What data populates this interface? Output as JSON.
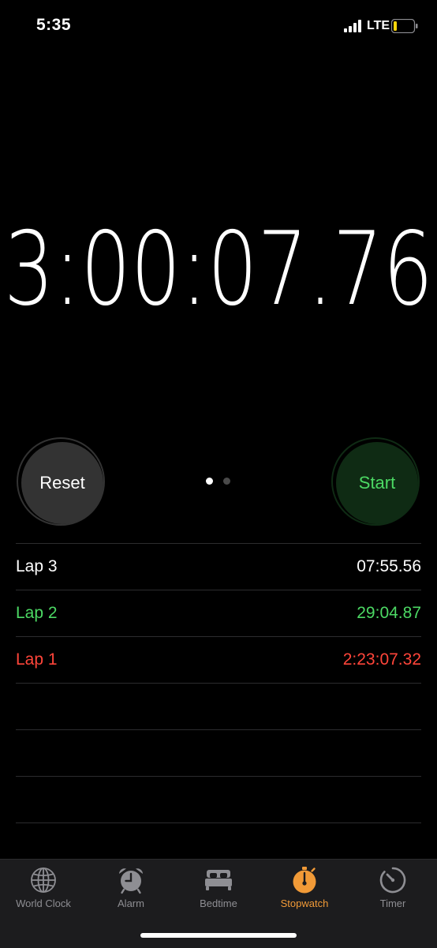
{
  "status_bar": {
    "time": "5:35",
    "network": "LTE",
    "icons": [
      "signal-bars-icon",
      "battery-low-icon"
    ]
  },
  "stopwatch": {
    "elapsed": "3:00:07.76"
  },
  "controls": {
    "reset_label": "Reset",
    "start_label": "Start",
    "page_count": 2,
    "active_page": 1
  },
  "laps": [
    {
      "name": "Lap 3",
      "time": "07:55.56",
      "color": "#ffffff"
    },
    {
      "name": "Lap 2",
      "time": "29:04.87",
      "color": "#4cd964"
    },
    {
      "name": "Lap 1",
      "time": "2:23:07.32",
      "color": "#ff453a"
    }
  ],
  "tab_bar": {
    "accent_color": "#f19a37",
    "tabs": [
      {
        "label": "World Clock",
        "icon": "globe-icon",
        "active": false
      },
      {
        "label": "Alarm",
        "icon": "alarm-clock-icon",
        "active": false
      },
      {
        "label": "Bedtime",
        "icon": "bed-icon",
        "active": false
      },
      {
        "label": "Stopwatch",
        "icon": "stopwatch-icon",
        "active": true
      },
      {
        "label": "Timer",
        "icon": "timer-icon",
        "active": false
      }
    ]
  }
}
